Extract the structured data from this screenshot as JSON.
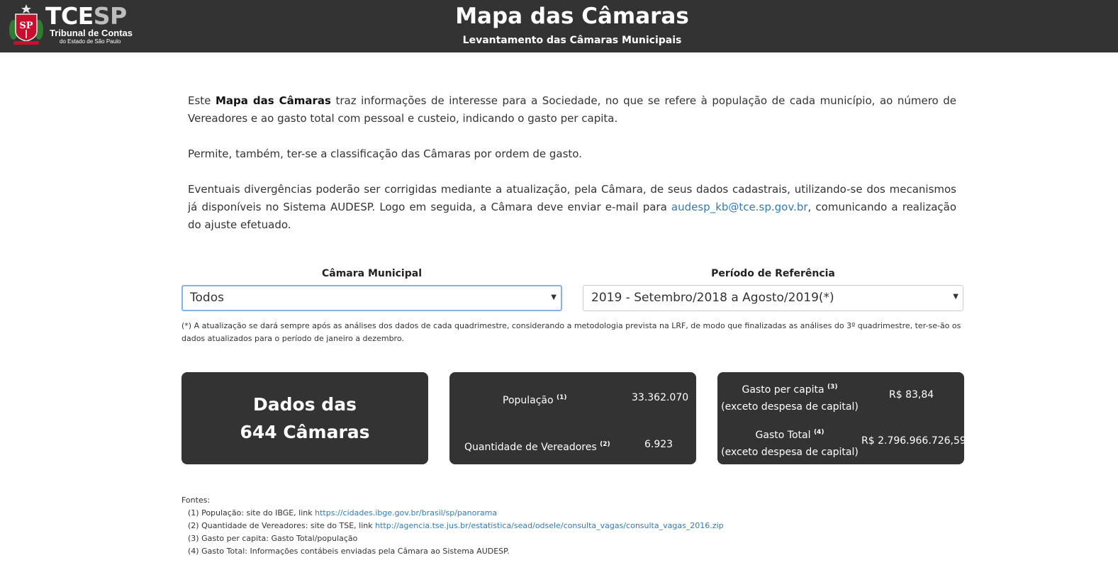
{
  "header": {
    "logo": {
      "brand_main": "TCE",
      "brand_sp": "SP",
      "line1": "Tribunal de Contas",
      "line2": "do Estado de São Paulo",
      "emblem_text": "SP"
    },
    "title": "Mapa das Câmaras",
    "subtitle": "Levantamento das Câmaras Municipais"
  },
  "intro": {
    "p1_prefix": "Este ",
    "p1_bold": "Mapa das Câmaras",
    "p1_rest": " traz informações de interesse para a Sociedade, no que se refere à população de cada município, ao número de Vereadores e ao gasto total com pessoal e custeio, indicando o gasto per capita.",
    "p2": "Permite, também, ter-se a classificação das Câmaras por ordem de gasto.",
    "p3_prefix": "Eventuais divergências poderão ser corrigidas mediante a atualização, pela Câmara, de seus dados cadastrais, utilizando-se dos mecanismos já disponíveis no Sistema AUDESP. Logo em seguida, a Câmara deve enviar e-mail para ",
    "p3_link": "audesp_kb@tce.sp.gov.br",
    "p3_suffix": ", comunicando a realização do ajuste efetuado."
  },
  "filters": {
    "camara": {
      "label": "Câmara Municipal",
      "value": "Todos"
    },
    "periodo": {
      "label": "Período de Referência",
      "value": "2019 - Setembro/2018 a Agosto/2019(*)"
    },
    "caret": "▼"
  },
  "note": "(*) A atualização se dará sempre após as análises dos dados de cada quadrimestre, considerando a metodologia prevista na LRF, de modo que finalizadas as análises do 3º quadrimestre, ter-se-ão os dados atualizados para o período de janeiro a dezembro.",
  "cards": {
    "summary": {
      "line1": "Dados das",
      "line2": "644 Câmaras"
    },
    "populacao": {
      "label": "População",
      "ref": "(1)",
      "value": "33.362.070"
    },
    "vereadores": {
      "label": "Quantidade de Vereadores",
      "ref": "(2)",
      "value": "6.923"
    },
    "gasto_per_capita": {
      "label": "Gasto per capita",
      "ref": "(3)",
      "sublabel": "(exceto despesa de capital)",
      "value": "R$ 83,84"
    },
    "gasto_total": {
      "label": "Gasto Total",
      "ref": "(4)",
      "sublabel": "(exceto despesa de capital)",
      "value": "R$ 2.796.966.726,59"
    }
  },
  "sources": {
    "title": "Fontes:",
    "s1_text": "(1) População: site do IBGE, link ",
    "s1_link": "https://cidades.ibge.gov.br/brasil/sp/panorama",
    "s2_text": "(2) Quantidade de Vereadores: site do TSE, link ",
    "s2_link": "http://agencia.tse.jus.br/estatistica/sead/odsele/consulta_vagas/consulta_vagas_2016.zip",
    "s3_text": "(3) Gasto per capita: Gasto Total/população",
    "s4_text": "(4) Gasto Total: Informações contábeis enviadas pela Câmara ao Sistema AUDESP."
  },
  "colors": {
    "header_bg": "#333333",
    "card_bg": "#333333",
    "link": "#337ab7",
    "focus_border": "#8ab0e6",
    "emblem_red": "#c8102e"
  }
}
